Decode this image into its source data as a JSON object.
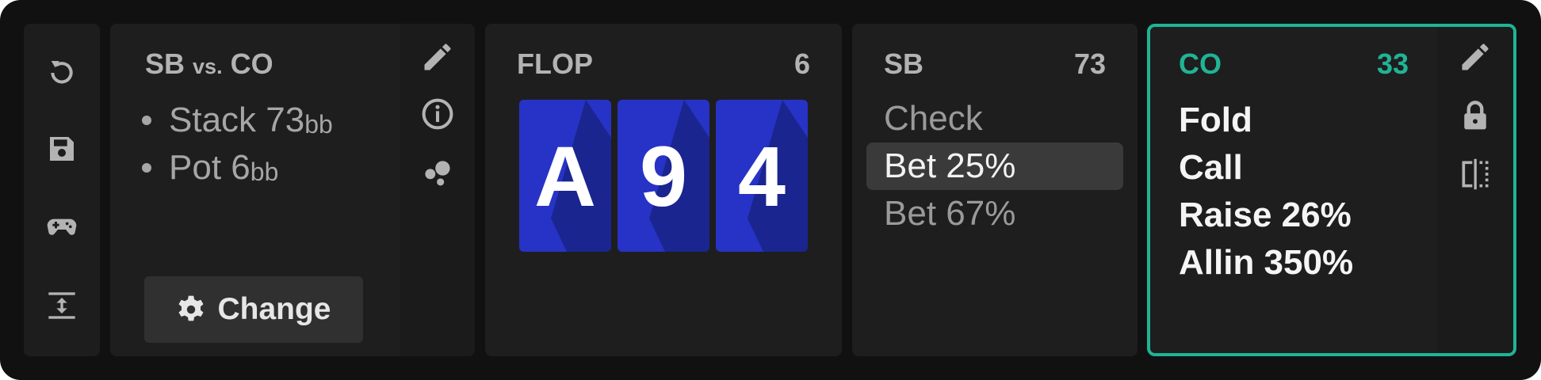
{
  "toolbar": {
    "icons": [
      "reset-icon",
      "save-icon",
      "gamepad-icon",
      "expand-vertical-icon"
    ]
  },
  "info": {
    "title_left": "SB",
    "title_vs": "vs.",
    "title_right": "CO",
    "stack_label": "Stack",
    "stack_value": "73",
    "stack_unit": "bb",
    "pot_label": "Pot",
    "pot_value": "6",
    "pot_unit": "bb",
    "change_label": "Change",
    "side_icons": [
      "pencil-icon",
      "info-icon",
      "bubbles-icon"
    ]
  },
  "flop": {
    "title": "FLOP",
    "count": "6",
    "cards": [
      "A",
      "9",
      "4"
    ],
    "card_color": "#2733c6"
  },
  "sb": {
    "title": "SB",
    "count": "73",
    "actions": [
      "Check",
      "Bet 25%",
      "Bet 67%"
    ],
    "selected": "Bet 25%"
  },
  "co": {
    "title": "CO",
    "count": "33",
    "accent": "#1fb495",
    "actions": [
      "Fold",
      "Call",
      "Raise 26%",
      "Allin 350%"
    ],
    "side_icons": [
      "pencil-icon",
      "lock-icon",
      "split-icon"
    ]
  }
}
